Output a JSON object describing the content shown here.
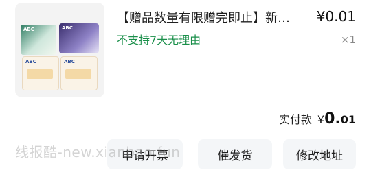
{
  "product": {
    "title": "【赠品数量有限赠完即止】新…",
    "price": "¥0.01",
    "notice": "不支持7天无理由",
    "quantity": "×1",
    "image_brand": "ABC"
  },
  "summary": {
    "paid_label": "实付款",
    "currency": "¥",
    "amount_int": "0.",
    "amount_dec": "01"
  },
  "actions": {
    "invoice": "申请开票",
    "urge": "催发货",
    "address": "修改地址"
  },
  "watermark": "线报酷-new.xianbao.fun",
  "colors": {
    "notice": "#1a8f4a",
    "button_bg": "#f4f6f8"
  }
}
